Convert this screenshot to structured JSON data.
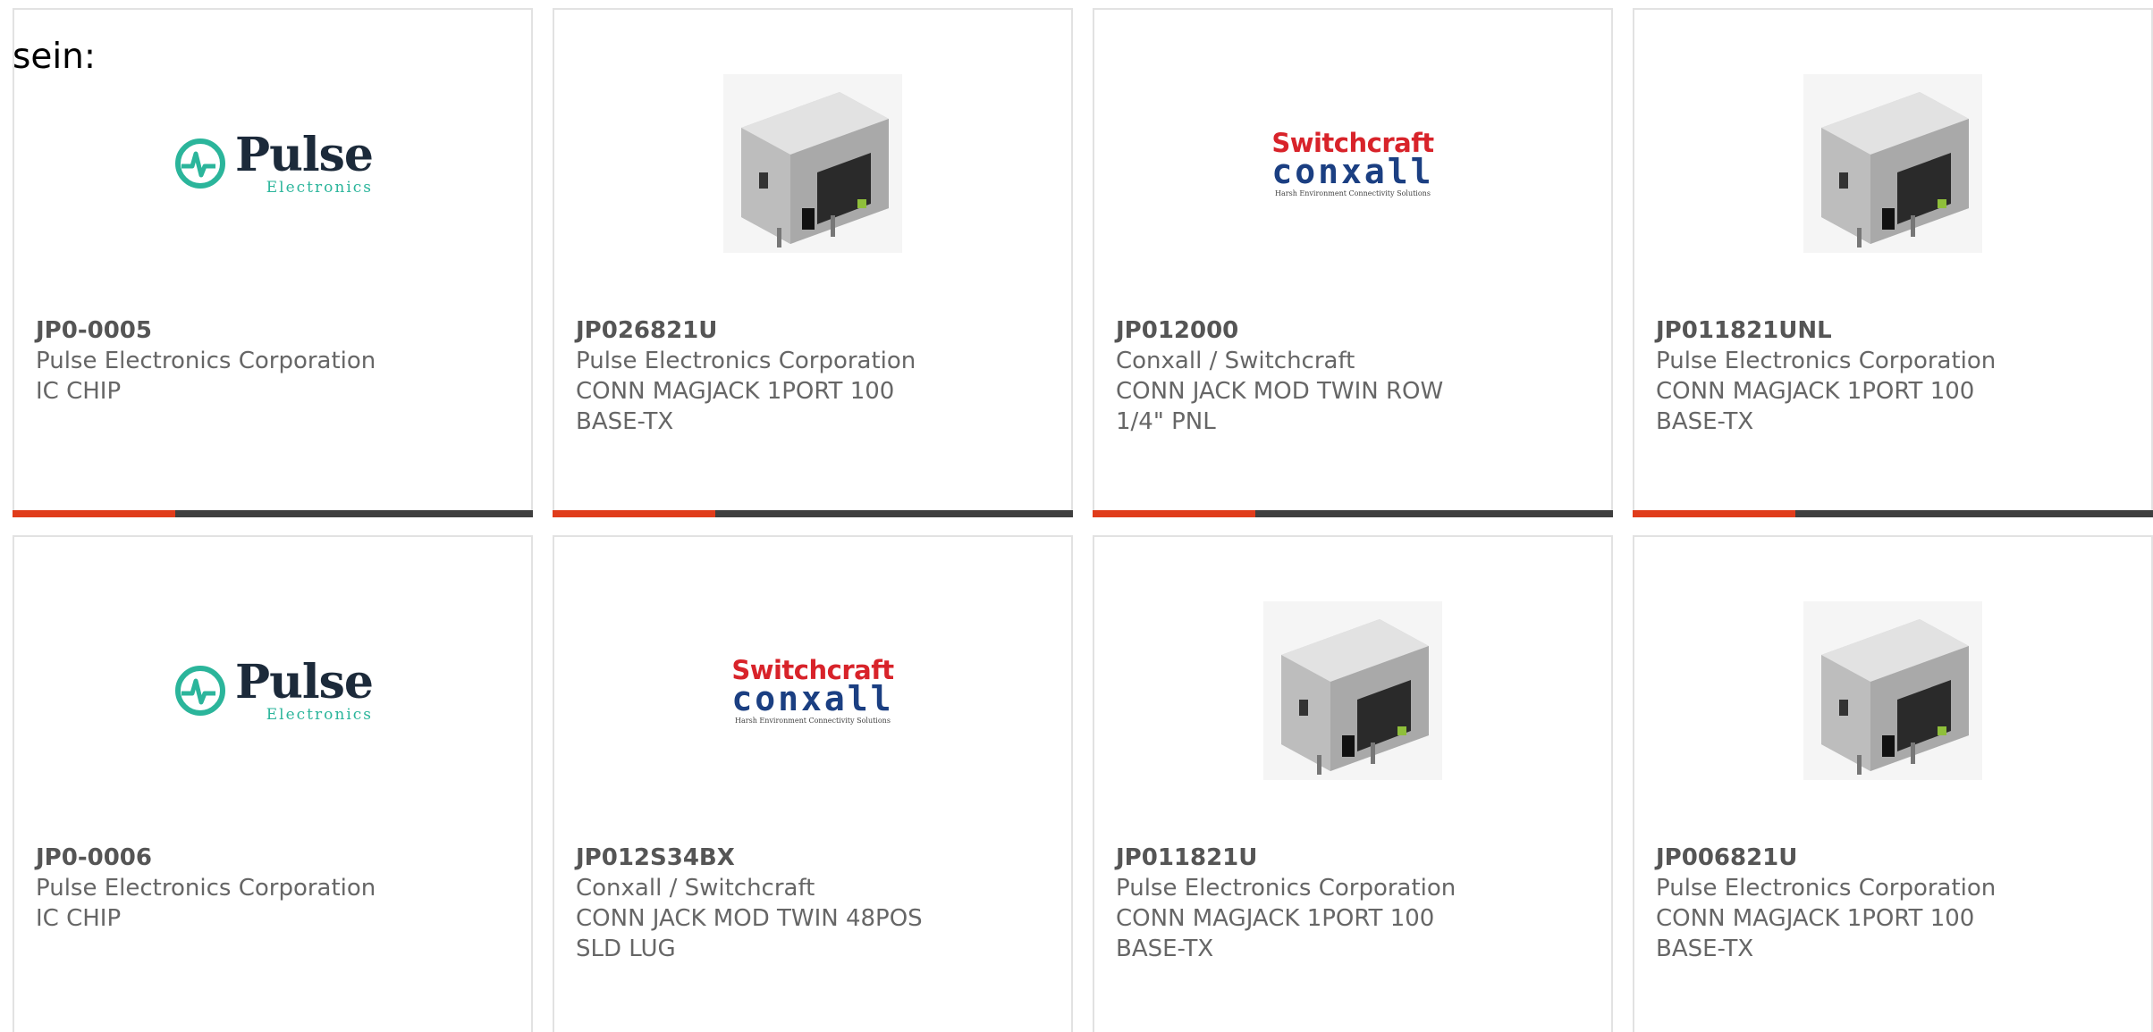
{
  "intro_text": "sein:",
  "colors": {
    "accent": "#e03c1b",
    "bar": "#3f3f3f",
    "card_border": "#e2e2e2",
    "text": "#666666"
  },
  "products": [
    {
      "part": "JP0-0005",
      "maker": "Pulse Electronics Corporation",
      "desc1": "IC CHIP",
      "desc2": "",
      "image": "pulse-logo",
      "logo_big": "Pulse",
      "logo_small": "Electronics"
    },
    {
      "part": "JP026821U",
      "maker": "Pulse Electronics Corporation",
      "desc1": "CONN MAGJACK 1PORT 100",
      "desc2": "BASE-TX",
      "image": "rj45-jack-photo"
    },
    {
      "part": "JP012000",
      "maker": "Conxall / Switchcraft",
      "desc1": "CONN JACK MOD TWIN ROW",
      "desc2": "1/4\" PNL",
      "image": "switchcraft-logo",
      "logo_top": "Switchcraft",
      "logo_mid": "conxall",
      "logo_tag": "Harsh Environment Connectivity Solutions"
    },
    {
      "part": "JP011821UNL",
      "maker": "Pulse Electronics Corporation",
      "desc1": "CONN MAGJACK 1PORT 100",
      "desc2": "BASE-TX",
      "image": "rj45-jack-photo"
    },
    {
      "part": "JP0-0006",
      "maker": "Pulse Electronics Corporation",
      "desc1": "IC CHIP",
      "desc2": "",
      "image": "pulse-logo",
      "logo_big": "Pulse",
      "logo_small": "Electronics"
    },
    {
      "part": "JP012S34BX",
      "maker": "Conxall / Switchcraft",
      "desc1": "CONN JACK MOD TWIN 48POS",
      "desc2": "SLD LUG",
      "image": "switchcraft-logo",
      "logo_top": "Switchcraft",
      "logo_mid": "conxall",
      "logo_tag": "Harsh Environment Connectivity Solutions"
    },
    {
      "part": "JP011821U",
      "maker": "Pulse Electronics Corporation",
      "desc1": "CONN MAGJACK 1PORT 100",
      "desc2": "BASE-TX",
      "image": "rj45-jack-photo"
    },
    {
      "part": "JP006821U",
      "maker": "Pulse Electronics Corporation",
      "desc1": "CONN MAGJACK 1PORT 100",
      "desc2": "BASE-TX",
      "image": "rj45-jack-photo"
    }
  ]
}
